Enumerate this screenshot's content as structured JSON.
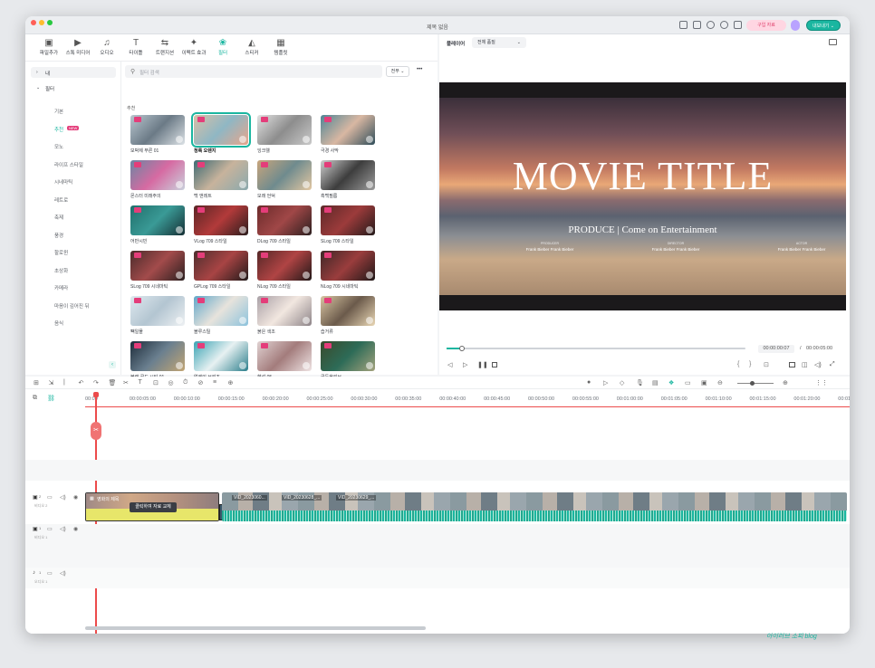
{
  "window": {
    "title": "제목 없음"
  },
  "header": {
    "upgrade_label": "구입 자료",
    "export_label": "내보내기 ⌄"
  },
  "toolbar": {
    "tools": [
      {
        "label": "파일추가",
        "glyph": "▣"
      },
      {
        "label": "스톡 미디어",
        "glyph": "▶"
      },
      {
        "label": "오디오",
        "glyph": "♫"
      },
      {
        "label": "타이틀",
        "glyph": "T"
      },
      {
        "label": "트랜지션",
        "glyph": "⇆"
      },
      {
        "label": "이펙트 효과",
        "glyph": "✦"
      },
      {
        "label": "필터",
        "glyph": "❀"
      },
      {
        "label": "스티커",
        "glyph": "◭"
      },
      {
        "label": "템플릿",
        "glyph": "▦"
      }
    ]
  },
  "sidebar": {
    "my_label": "내",
    "filter_label": "필터",
    "items": [
      "기본",
      "추천",
      "모노",
      "라이프 스타일",
      "시네마틱",
      "레트로",
      "축제",
      "풍경",
      "할로윈",
      "초상화",
      "카메라",
      "마음이 깊어진 뒤",
      "음식"
    ],
    "new_badge": "NEW"
  },
  "search": {
    "placeholder": "필터 검색",
    "filter_option": "전부 ⌄",
    "more": "•••"
  },
  "section_label": "추천",
  "filters": [
    "모박제 푸른 01",
    "청록 오렌지",
    "잉크웰",
    "극경 사막",
    "몬스터 미래주의",
    "백 앤레트",
    "모래 언덕",
    "흑백필름",
    "어반시빈",
    "VLog 709 스타일",
    "DLog 709 스타일",
    "SLog 709 스타일",
    "SLog 709 시네마틱",
    "GPLog 709 스타일",
    "NLog 709 스타일",
    "NLog 709 시네마틱",
    "빽일몰",
    "블루스틸",
    "붉은 색조",
    "습거류",
    "블랙 골드 시티 01",
    "얼레인 브리즈",
    "혜선 05",
    "골든올리브"
  ],
  "player": {
    "tab_label": "플레이어",
    "quality": "전체 품질",
    "movie_title": "MOVIE TITLE",
    "produce_line": "PRODUCE | Come on Entertainment",
    "credits": [
      {
        "role": "PRODUCER",
        "name": "Frank Bieber Frank Bieber"
      },
      {
        "role": "DIRECTOR",
        "name": "Frank Bieber Frank Bieber"
      },
      {
        "role": "ACTOR",
        "name": "Frank Bieber Frank Bieber"
      }
    ],
    "current_time": "00:00:00:07",
    "separator": "/",
    "total_time": "00:00:05:00",
    "progress": 0.05
  },
  "timeline": {
    "ticks": [
      "00:00",
      "00:00:05:00",
      "00:00:10:00",
      "00:00:15:00",
      "00:00:20:00",
      "00:00:25:00",
      "00:00:30:00",
      "00:00:35:00",
      "00:00:40:00",
      "00:00:45:00",
      "00:00:50:00",
      "00:00:55:00",
      "00:01:00:00",
      "00:01:05:00",
      "00:01:10:00",
      "00:01:15:00",
      "00:01:20:00",
      "00:01:25:00"
    ],
    "tracks": [
      {
        "num": "2",
        "label": "비디오 2"
      },
      {
        "num": "1",
        "label": "비디오 1"
      },
      {
        "num": "1",
        "label": "오디오 1"
      }
    ],
    "clip_title": "영화의 제목",
    "replace_tooltip": "클릭하여 자료 교체",
    "video_clips": [
      "VID_2023060...",
      "VID_20230628_...",
      "VID_20230629_..."
    ]
  },
  "watermark": "아이러브 소피 blog"
}
